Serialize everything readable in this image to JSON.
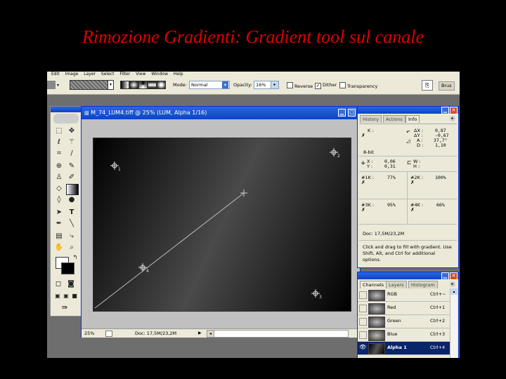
{
  "slide_title": "Rimozione Gradienti: Gradient tool sul canale",
  "menubar": [
    "Edit",
    "Image",
    "Layer",
    "Select",
    "Filter",
    "View",
    "Window",
    "Help"
  ],
  "options": {
    "mode_label": "Mode:",
    "mode_value": "Normal",
    "opacity_label": "Opacity:",
    "opacity_value": "16%",
    "reverse_label": "Reverse",
    "reverse_checked": false,
    "dither_label": "Dither",
    "dither_checked": true,
    "transparency_label": "Transparency",
    "transparency_checked": false,
    "brush_tab": "Brus"
  },
  "document": {
    "title": "M_74_LUM4.tiff @ 25% (LUM, Alpha 1/16)",
    "zoom": "25%",
    "doc_info": "Doc: 17,5M/23,2M",
    "markers": [
      "1",
      "2",
      "3",
      "4"
    ]
  },
  "info_panel": {
    "tabs": [
      "History",
      "Actions",
      "Info"
    ],
    "k_label": "K :",
    "bit_depth": "8-bit",
    "dx_label": "ΔX :",
    "dx_value": "0,87",
    "dy_label": "ΔY :",
    "dy_value": "-0,67",
    "a_label": "A :",
    "a_value": "37,7°",
    "d_label": "D :",
    "d_value": "1,10",
    "x_label": "X :",
    "x_value": "0,06",
    "y_label": "Y :",
    "y_value": "0,31",
    "w_label": "W :",
    "h_label": "H :",
    "s1_label": "#1K :",
    "s1_value": "77%",
    "s2_label": "#2K :",
    "s2_value": "100%",
    "s3_label": "#3K :",
    "s3_value": "95%",
    "s4_label": "#4K :",
    "s4_value": "66%",
    "doc_info": "Doc: 17,5M/23,2M",
    "hint": "Click and drag to fill with gradient.  Use Shift, Alt, and Ctrl for additional options."
  },
  "channels_panel": {
    "tabs": [
      "Channels",
      "Layers",
      "Histogram"
    ],
    "channels": [
      {
        "name": "RGB",
        "shortcut": "Ctrl+~"
      },
      {
        "name": "Red",
        "shortcut": "Ctrl+1"
      },
      {
        "name": "Green",
        "shortcut": "Ctrl+2"
      },
      {
        "name": "Blue",
        "shortcut": "Ctrl+3"
      },
      {
        "name": "Alpha 1",
        "shortcut": "Ctrl+4"
      }
    ]
  },
  "colors": {
    "title_red": "#e00000",
    "xp_blue": "#0a44c8"
  }
}
